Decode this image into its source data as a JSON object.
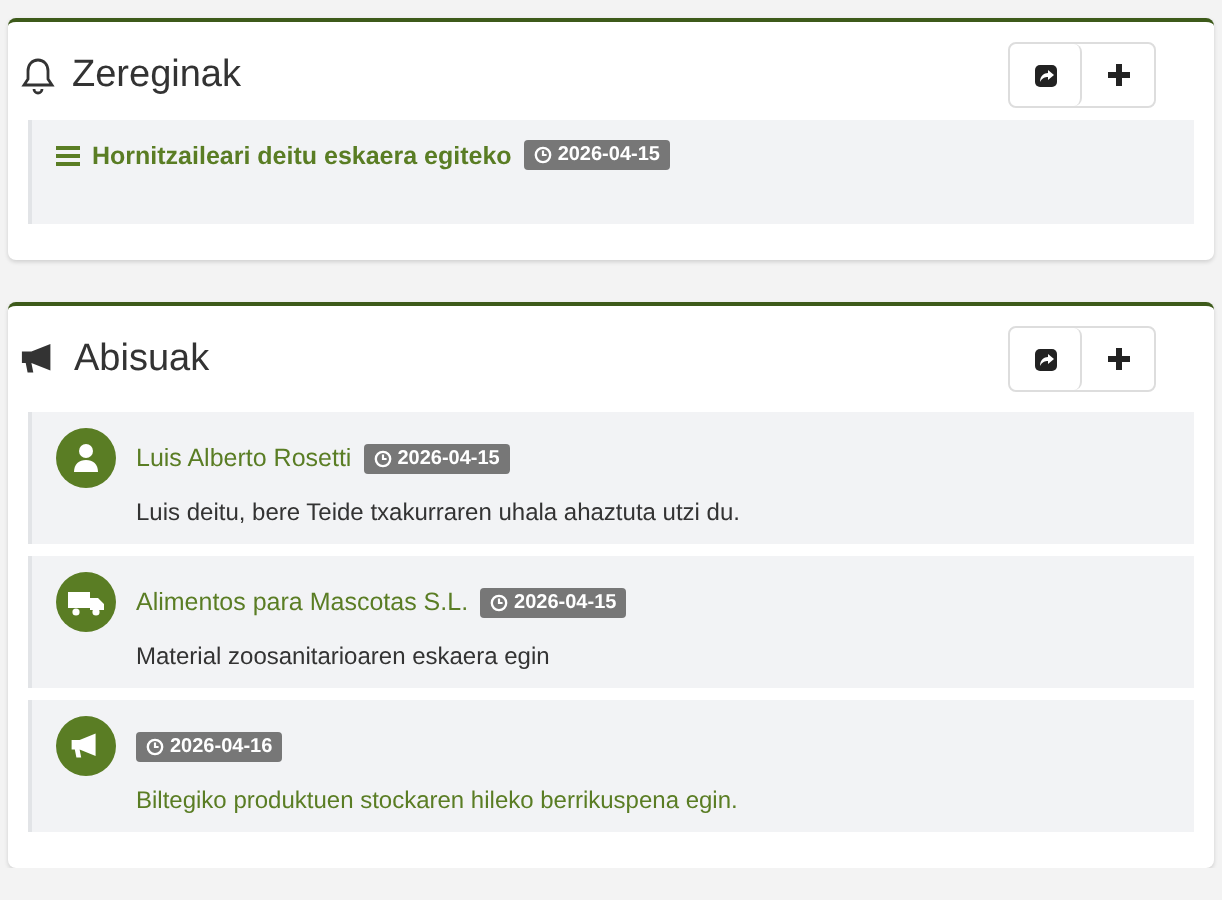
{
  "panels": [
    {
      "title": "Zereginak",
      "kind": "tasks",
      "items": [
        {
          "title": "Hornitzaileari deitu eskaera egiteko",
          "date": "2026-04-15"
        }
      ]
    },
    {
      "title": "Abisuak",
      "kind": "notices",
      "items": [
        {
          "kind": "person",
          "sender": "Luis Alberto Rosetti",
          "date": "2026-04-15",
          "message": "Luis deitu, bere Teide txakurraren uhala ahaztuta utzi du."
        },
        {
          "kind": "supplier",
          "sender": "Alimentos para Mascotas S.L.",
          "date": "2026-04-15",
          "message": "Material zoosanitarioaren eskaera egin"
        },
        {
          "kind": "announcement",
          "date": "2026-04-16",
          "message": "Biltegiko produktuen stockaren hileko berrikuspena egin."
        }
      ]
    }
  ]
}
